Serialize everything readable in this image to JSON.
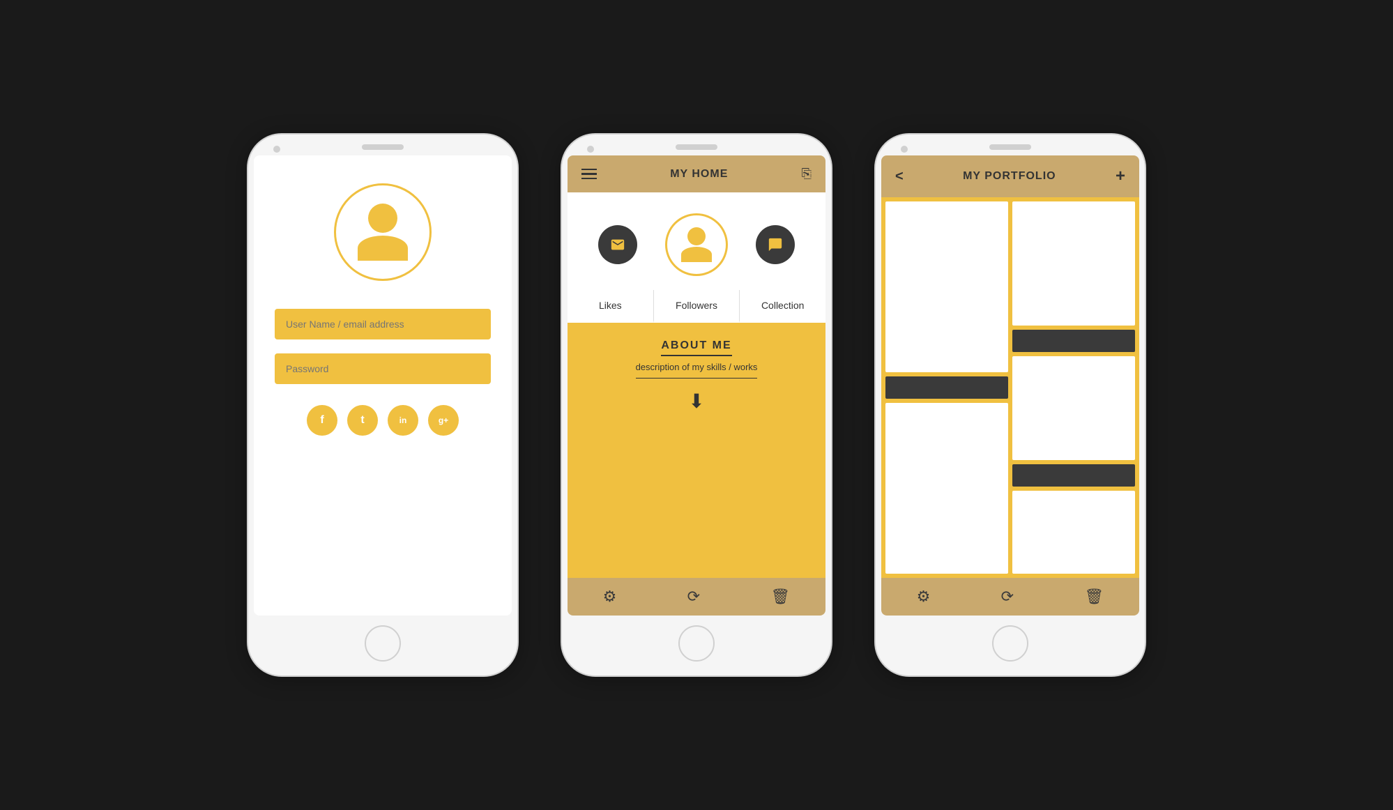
{
  "phone1": {
    "screen": "login",
    "avatar_label": "user avatar",
    "inputs": [
      {
        "id": "username",
        "placeholder": "User Name / email address"
      },
      {
        "id": "password",
        "placeholder": "Password"
      }
    ],
    "social": [
      {
        "id": "facebook",
        "label": "f"
      },
      {
        "id": "twitter",
        "label": "t"
      },
      {
        "id": "linkedin",
        "label": "in"
      },
      {
        "id": "googleplus",
        "label": "g+"
      }
    ]
  },
  "phone2": {
    "screen": "my_home",
    "header": {
      "title": "MY HOME",
      "menu_icon": "hamburger-menu",
      "edit_icon": "edit"
    },
    "tabs": [
      {
        "id": "likes",
        "label": "Likes"
      },
      {
        "id": "followers",
        "label": "Followers"
      },
      {
        "id": "collection",
        "label": "Collection"
      }
    ],
    "about": {
      "title": "ABOUT ME",
      "description": "description of my skills / works",
      "arrow": "↓"
    },
    "bottom_bar": [
      {
        "id": "settings",
        "icon": "gear"
      },
      {
        "id": "refresh",
        "icon": "refresh"
      },
      {
        "id": "delete",
        "icon": "trash"
      }
    ]
  },
  "phone3": {
    "screen": "my_portfolio",
    "header": {
      "title": "MY PORTFOLIO",
      "back_icon": "back",
      "add_icon": "plus"
    },
    "portfolio_items": [
      {
        "type": "tall-card",
        "col": 1
      },
      {
        "type": "card",
        "col": 2
      },
      {
        "type": "label",
        "col": 2
      },
      {
        "type": "card",
        "col": 2
      },
      {
        "type": "label",
        "col": 1
      },
      {
        "type": "card-sm",
        "col": 1
      },
      {
        "type": "label",
        "col": 2
      },
      {
        "type": "card-sm",
        "col": 2
      }
    ],
    "bottom_bar": [
      {
        "id": "settings",
        "icon": "gear"
      },
      {
        "id": "refresh",
        "icon": "refresh"
      },
      {
        "id": "delete",
        "icon": "trash"
      }
    ]
  }
}
